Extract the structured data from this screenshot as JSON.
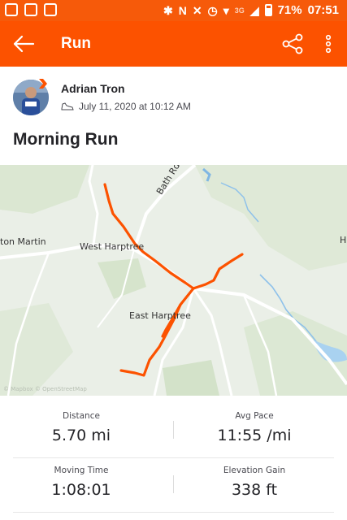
{
  "status_bar": {
    "battery_percent": "71%",
    "time": "07:51",
    "network": "3G",
    "icons": [
      "notification-icon",
      "image-icon",
      "strava-app-icon",
      "bluetooth-icon",
      "nfc-icon",
      "mute-icon",
      "alarm-icon",
      "wifi-icon",
      "signal-icon",
      "battery-icon"
    ]
  },
  "app_bar": {
    "title": "Run",
    "icons": [
      "back-arrow-icon",
      "share-icon",
      "more-vertical-icon"
    ]
  },
  "athlete": {
    "name": "Adrian Tron",
    "date": "July 11, 2020 at 10:12 AM",
    "icons": [
      "avatar",
      "run-shoe-icon"
    ]
  },
  "activity": {
    "title": "Morning Run"
  },
  "map": {
    "labels": [
      "ton Martin",
      "West Harptree",
      "Bath Rd",
      "East Harptree",
      "H"
    ],
    "attribution": "© Mapbox © OpenStreetMap",
    "route_color": "#fc5200"
  },
  "stats": [
    {
      "label": "Distance",
      "value": "5.70 mi"
    },
    {
      "label": "Avg Pace",
      "value": "11:55 /mi"
    },
    {
      "label": "Moving Time",
      "value": "1:08:01"
    },
    {
      "label": "Elevation Gain",
      "value": "338 ft"
    }
  ],
  "colors": {
    "brand": "#fc5200",
    "status_bar": "#f65a0a",
    "text": "#242428"
  }
}
